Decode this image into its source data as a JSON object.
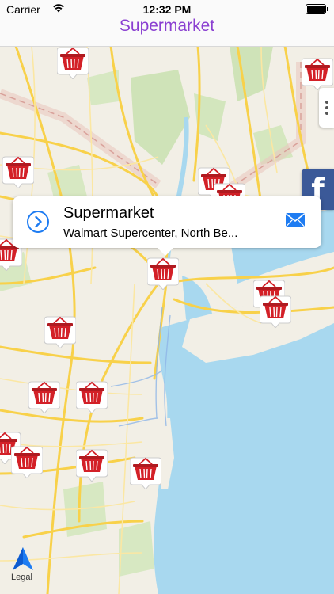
{
  "status_bar": {
    "carrier": "Carrier",
    "time": "12:32 PM"
  },
  "nav": {
    "title": "Supermarket"
  },
  "callout": {
    "title": "Supermarket",
    "subtitle": "Walmart Supercenter, North Be..."
  },
  "map": {
    "legal": "Legal"
  },
  "colors": {
    "nav_title": "#8a3fd1",
    "pin": "#d32027",
    "facebook": "#3b5998",
    "water": "#a8d8ef",
    "road": "#f8d14a"
  },
  "icons": [
    "wifi-icon",
    "battery-icon",
    "detail-disclosure-icon",
    "mail-icon",
    "facebook-icon",
    "shopping-basket-icon",
    "location-arrow-icon"
  ]
}
